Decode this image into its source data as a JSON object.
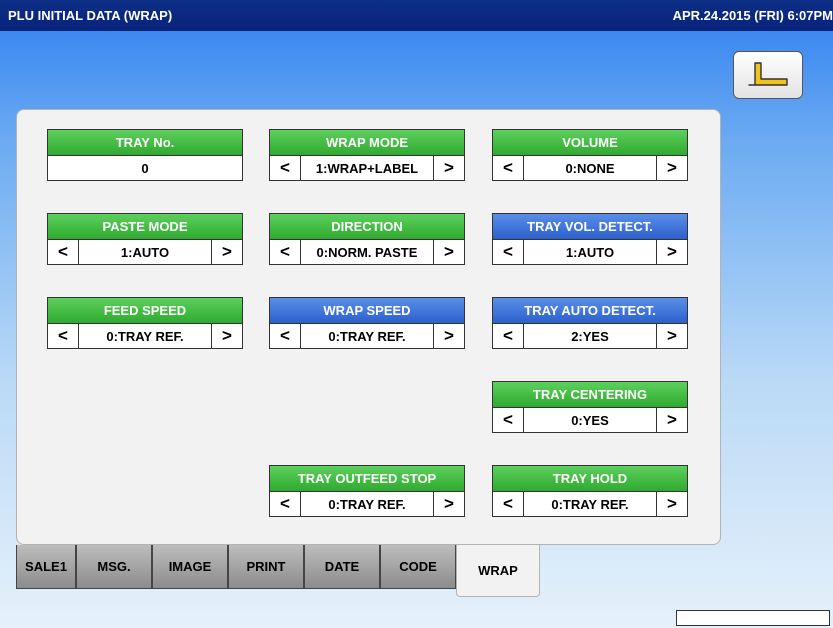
{
  "header": {
    "title": "PLU INITIAL DATA (WRAP)",
    "datetime": "APR.24.2015 (FRI)  6:07PM"
  },
  "back_button": {
    "icon": "back-arrow-icon"
  },
  "fields": {
    "tray_no": {
      "label": "TRAY No.",
      "value": "0"
    },
    "wrap_mode": {
      "label": "WRAP MODE",
      "value": "1:WRAP+LABEL"
    },
    "volume": {
      "label": "VOLUME",
      "value": "0:NONE"
    },
    "paste_mode": {
      "label": "PASTE MODE",
      "value": "1:AUTO"
    },
    "direction": {
      "label": "DIRECTION",
      "value": "0:NORM. PASTE"
    },
    "tray_vol_detect": {
      "label": "TRAY VOL. DETECT.",
      "value": "1:AUTO"
    },
    "feed_speed": {
      "label": "FEED SPEED",
      "value": "0:TRAY REF."
    },
    "wrap_speed": {
      "label": "WRAP SPEED",
      "value": "0:TRAY REF."
    },
    "tray_auto_detect": {
      "label": "TRAY AUTO DETECT.",
      "value": "2:YES"
    },
    "tray_centering": {
      "label": "TRAY CENTERING",
      "value": "0:YES"
    },
    "tray_outfeed_stop": {
      "label": "TRAY OUTFEED STOP",
      "value": "0:TRAY REF."
    },
    "tray_hold": {
      "label": "TRAY HOLD",
      "value": "0:TRAY REF."
    }
  },
  "arrows": {
    "left": "<",
    "right": ">"
  },
  "tabs": [
    "SALE1",
    "MSG.",
    "IMAGE",
    "PRINT",
    "DATE",
    "CODE",
    "WRAP"
  ],
  "active_tab": "WRAP",
  "colors": {
    "green_header": "#2faa2f",
    "blue_header": "#2c60cc",
    "title_bar": "#08227a"
  }
}
